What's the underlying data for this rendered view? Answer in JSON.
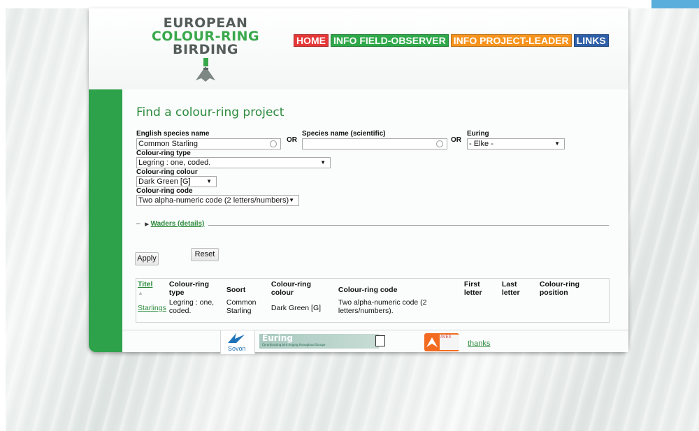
{
  "logo": {
    "line1": "EUROPEAN",
    "line2": "COLOUR-RING",
    "line3": "BIRDING"
  },
  "nav": [
    {
      "label": "HOME",
      "color": "#e53838"
    },
    {
      "label": "INFO FIELD-OBSERVER",
      "color": "#2fa84a"
    },
    {
      "label": "INFO PROJECT-LEADER",
      "color": "#f7941e"
    },
    {
      "label": "LINKS",
      "color": "#2e5fa8"
    }
  ],
  "page_title": "Find a colour-ring project",
  "form": {
    "english_species_label": "English species name",
    "english_species_value": "Common Starling",
    "or_label": "OR",
    "scientific_label": "Species name (scientific)",
    "scientific_value": "",
    "euring_label": "Euring",
    "euring_value": "- Elke -",
    "ring_type_label": "Colour-ring type",
    "ring_type_value": "Legring : one, coded.",
    "ring_colour_label": "Colour-ring colour",
    "ring_colour_value": "Dark Green [G]",
    "ring_code_label": "Colour-ring code",
    "ring_code_value": "Two alpha-numeric code (2 letters/numbers)",
    "waders_link": "Waders (details)",
    "apply_label": "Apply",
    "reset_label": "Reset"
  },
  "results": {
    "headers": [
      "Titel",
      "Colour-ring type",
      "Soort",
      "Colour-ring colour",
      "Colour-ring code",
      "First letter",
      "Last letter",
      "Colour-ring position"
    ],
    "rows": [
      [
        "Starlings",
        "Legring : one, coded.",
        "Common Starling",
        "Dark Green [G]",
        "Two alpha-numeric code (2 letters/numbers).",
        "",
        "",
        ""
      ]
    ]
  },
  "footer": {
    "sovon": "Sovon",
    "euring_title": "Euring",
    "euring_sub": "Co-ordinating bird ringing throughout Europe",
    "aves": "AVES",
    "thanks": "thanks"
  }
}
